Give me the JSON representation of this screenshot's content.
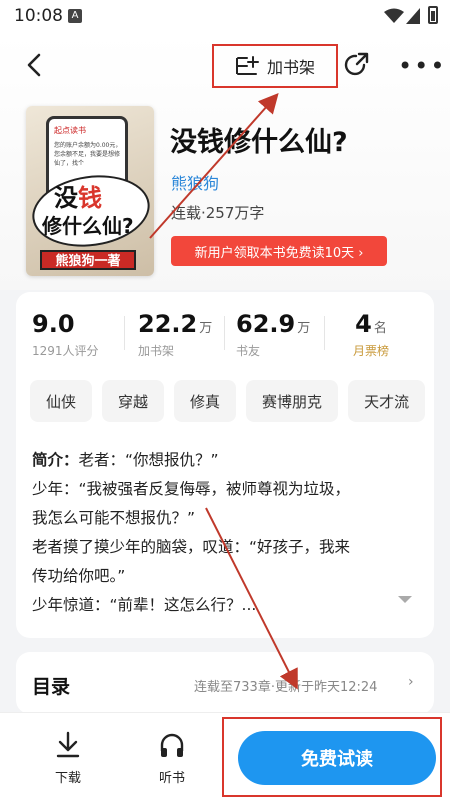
{
  "status_bar": {
    "time": "10:08",
    "notification_letter": "A"
  },
  "nav": {
    "add_shelf_label": "加书架"
  },
  "cover": {
    "logo": "起点读书",
    "phone_text": "您的账户余额为0.00元，您余额不足，我要是想修仙了，找个",
    "title_line1_a": "没",
    "title_line1_b": "钱",
    "title_line2": "修什么仙?",
    "author_band": "熊狼狗一著"
  },
  "book": {
    "title": "没钱修什么仙?",
    "author": "熊狼狗",
    "meta": "连载·257万字",
    "promo": "新用户领取本书免费读10天 ›"
  },
  "stats": [
    {
      "num": "9.0",
      "unit": "",
      "sub": "1291人评分"
    },
    {
      "num": "22.2",
      "unit": "万",
      "sub": "加书架"
    },
    {
      "num": "62.9",
      "unit": "万",
      "sub": "书友"
    },
    {
      "num": "4",
      "unit": "名",
      "sub": "月票榜"
    }
  ],
  "tags": [
    "仙侠",
    "穿越",
    "修真",
    "赛博朋克",
    "天才流"
  ],
  "intro": {
    "label": "简介：",
    "lines": [
      "老者：“你想报仇？”",
      "少年：“我被强者反复侮辱，被师尊视为垃圾，",
      "我怎么可能不想报仇？”",
      "老者摸了摸少年的脑袋，叹道：“好孩子，我来",
      "传功给你吧。”",
      "少年惊道：“前辈！这怎么行？..."
    ]
  },
  "toc": {
    "label": "目录",
    "info": "连载至733章·更新于昨天12:24"
  },
  "bottom": {
    "download": "下载",
    "listen": "听书",
    "read": "免费试读"
  },
  "colors": {
    "accent_blue": "#1e96f0",
    "promo_red": "#f2473b",
    "annotation_red": "#d9362c",
    "author_blue": "#2a86d8"
  }
}
